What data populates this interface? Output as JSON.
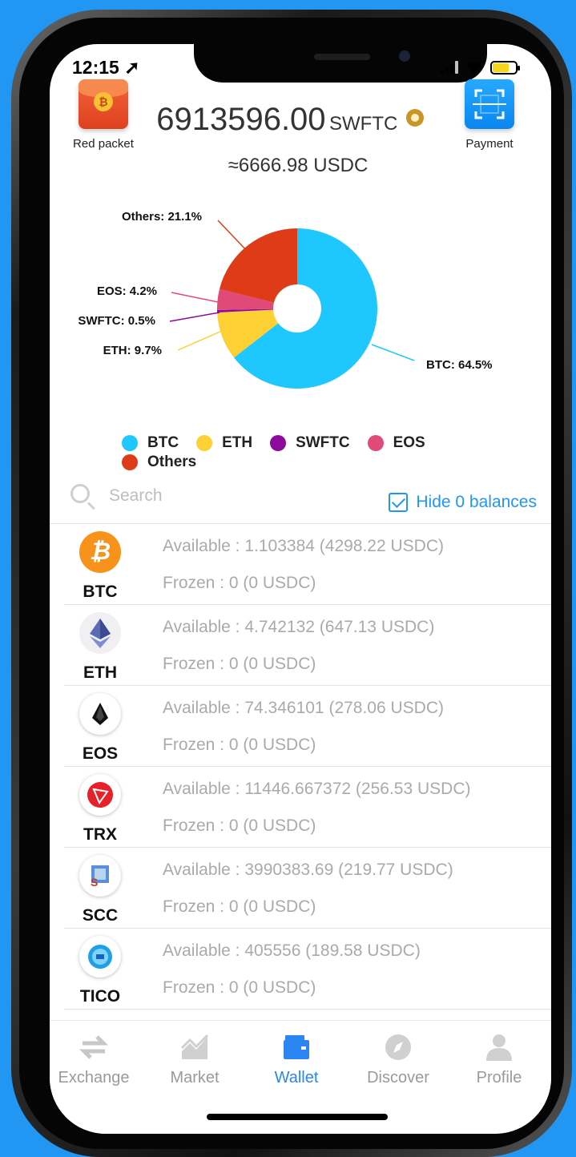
{
  "status": {
    "time": "12:15 ➚"
  },
  "header": {
    "red_packet_label": "Red packet",
    "payment_label": "Payment",
    "balance_amount": "6913596.00",
    "balance_unit": "SWFTC",
    "usd_equivalent": "≈6666.98 USDC"
  },
  "chart_data": {
    "type": "pie",
    "slices": [
      {
        "name": "BTC",
        "value": 64.5,
        "label": "BTC: 64.5%",
        "color": "#1ec8fe"
      },
      {
        "name": "ETH",
        "value": 9.7,
        "label": "ETH: 9.7%",
        "color": "#fdd033"
      },
      {
        "name": "SWFTC",
        "value": 0.5,
        "label": "SWFTC: 0.5%",
        "color": "#8e0a9c"
      },
      {
        "name": "EOS",
        "value": 4.2,
        "label": "EOS: 4.2%",
        "color": "#e04a78"
      },
      {
        "name": "Others",
        "value": 21.1,
        "label": "Others: 21.1%",
        "color": "#de3c18"
      }
    ],
    "legend": [
      "BTC",
      "ETH",
      "SWFTC",
      "EOS",
      "Others"
    ],
    "donut": true
  },
  "search": {
    "placeholder": "Search",
    "hide_zero_label": "Hide 0 balances",
    "hide_zero_checked": true
  },
  "assets": [
    {
      "symbol": "BTC",
      "available": "Available : 1.103384 (4298.22 USDC)",
      "frozen": "Frozen : 0 (0 USDC)"
    },
    {
      "symbol": "ETH",
      "available": "Available : 4.742132 (647.13 USDC)",
      "frozen": "Frozen : 0 (0 USDC)"
    },
    {
      "symbol": "EOS",
      "available": "Available : 74.346101 (278.06 USDC)",
      "frozen": "Frozen : 0 (0 USDC)"
    },
    {
      "symbol": "TRX",
      "available": "Available : 11446.667372 (256.53 USDC)",
      "frozen": "Frozen : 0 (0 USDC)"
    },
    {
      "symbol": "SCC",
      "available": "Available : 3990383.69 (219.77 USDC)",
      "frozen": "Frozen : 0 (0 USDC)"
    },
    {
      "symbol": "TICO",
      "available": "Available : 405556 (189.58 USDC)",
      "frozen": "Frozen : 0 (0 USDC)"
    }
  ],
  "tabs": [
    {
      "label": "Exchange",
      "icon": "exchange-icon"
    },
    {
      "label": "Market",
      "icon": "market-icon"
    },
    {
      "label": "Wallet",
      "icon": "wallet-icon",
      "active": true
    },
    {
      "label": "Discover",
      "icon": "compass-icon"
    },
    {
      "label": "Profile",
      "icon": "profile-icon"
    }
  ],
  "colors": {
    "accent": "#2196f3",
    "tab_active": "#2b86f1",
    "muted_text": "#aaaaaa"
  }
}
